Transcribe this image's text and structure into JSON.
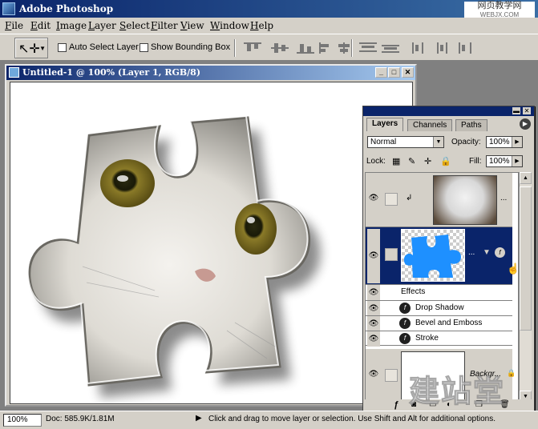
{
  "app": {
    "title": "Adobe Photoshop"
  },
  "watermark_top": {
    "line1": "网页教学网",
    "line2": "WEBJX.COM"
  },
  "menu": [
    "File",
    "Edit",
    "Image",
    "Layer",
    "Select",
    "Filter",
    "View",
    "Window",
    "Help"
  ],
  "options": {
    "auto_select_label": "Auto Select Layer",
    "show_bounding_label": "Show Bounding Box"
  },
  "document": {
    "title": "Untitled-1 @ 100% (Layer 1, RGB/8)"
  },
  "layers_palette": {
    "tabs": [
      "Layers",
      "Channels",
      "Paths"
    ],
    "blend_mode": "Normal",
    "opacity_label": "Opacity:",
    "opacity_value": "100%",
    "lock_label": "Lock:",
    "fill_label": "Fill:",
    "fill_value": "100%",
    "effects_header": "Effects",
    "effects": [
      "Drop Shadow",
      "Bevel and Emboss",
      "Stroke"
    ],
    "background_label": "Backgr..."
  },
  "status": {
    "zoom": "100%",
    "doc_size": "Doc: 585.9K/1.81M",
    "hint": "Click and drag to move layer or selection. Use Shift and Alt for additional options."
  },
  "watermark_bottom": "建站堂",
  "colors": {
    "title_active": "#0a246a",
    "selected_layer": "#0a246a",
    "puzzle_blue": "#1e90ff"
  }
}
